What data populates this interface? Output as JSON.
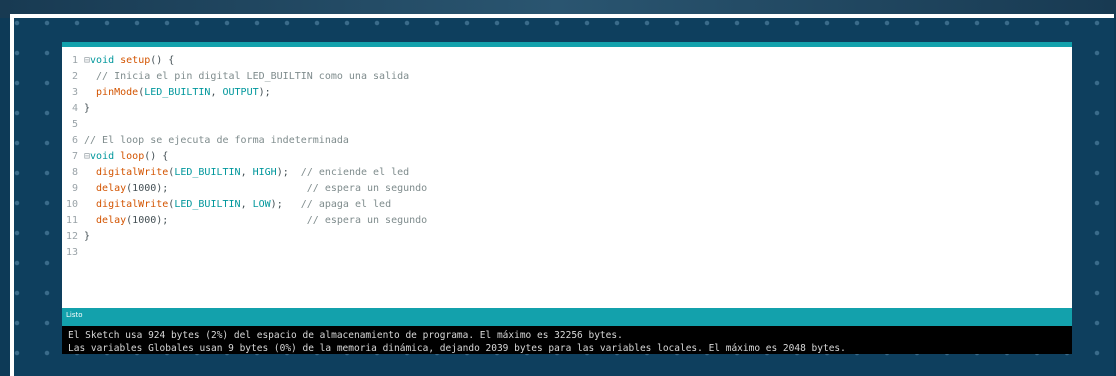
{
  "status_bar": {
    "label": "Listo"
  },
  "code": [
    {
      "n": "1",
      "fold": "⊟",
      "parts": [
        [
          "kw",
          "void "
        ],
        [
          "fn",
          "setup"
        ],
        [
          "",
          "() {"
        ]
      ]
    },
    {
      "n": "2",
      "fold": "",
      "parts": [
        [
          "cm",
          "  // Inicia el pin digital LED_BUILTIN como una salida"
        ]
      ]
    },
    {
      "n": "3",
      "fold": "",
      "parts": [
        [
          "fn",
          "  pinMode"
        ],
        [
          "",
          "("
        ],
        [
          "const",
          "LED_BUILTIN"
        ],
        [
          "",
          ", "
        ],
        [
          "const",
          "OUTPUT"
        ],
        [
          "",
          ");"
        ]
      ]
    },
    {
      "n": "4",
      "fold": "",
      "parts": [
        [
          "",
          "}"
        ]
      ]
    },
    {
      "n": "5",
      "fold": "",
      "parts": [
        [
          "",
          ""
        ]
      ]
    },
    {
      "n": "6",
      "fold": "",
      "parts": [
        [
          "cm",
          "// El loop se ejecuta de forma indeterminada"
        ]
      ]
    },
    {
      "n": "7",
      "fold": "⊟",
      "parts": [
        [
          "kw",
          "void "
        ],
        [
          "fn",
          "loop"
        ],
        [
          "",
          "() {"
        ]
      ]
    },
    {
      "n": "8",
      "fold": "",
      "parts": [
        [
          "fn",
          "  digitalWrite"
        ],
        [
          "",
          "("
        ],
        [
          "const",
          "LED_BUILTIN"
        ],
        [
          "",
          ", "
        ],
        [
          "const",
          "HIGH"
        ],
        [
          "",
          ");  "
        ],
        [
          "cm",
          "// enciende el led"
        ]
      ]
    },
    {
      "n": "9",
      "fold": "",
      "parts": [
        [
          "fn",
          "  delay"
        ],
        [
          "",
          "(1000);                       "
        ],
        [
          "cm",
          "// espera un segundo"
        ]
      ]
    },
    {
      "n": "10",
      "fold": "",
      "parts": [
        [
          "fn",
          "  digitalWrite"
        ],
        [
          "",
          "("
        ],
        [
          "const",
          "LED_BUILTIN"
        ],
        [
          "",
          ", "
        ],
        [
          "const",
          "LOW"
        ],
        [
          "",
          ");   "
        ],
        [
          "cm",
          "// apaga el led"
        ]
      ]
    },
    {
      "n": "11",
      "fold": "",
      "parts": [
        [
          "fn",
          "  delay"
        ],
        [
          "",
          "(1000);                       "
        ],
        [
          "cm",
          "// espera un segundo"
        ]
      ]
    },
    {
      "n": "12",
      "fold": "",
      "parts": [
        [
          "",
          "}"
        ]
      ]
    },
    {
      "n": "13",
      "fold": "",
      "parts": [
        [
          "",
          ""
        ]
      ]
    }
  ],
  "console": {
    "line1": "El Sketch usa 924 bytes (2%) del espacio de almacenamiento de programa. El máximo es 32256 bytes.",
    "line2": "Las variables Globales usan 9 bytes (0%) de la memoria dinámica, dejando 2039 bytes para las variables locales. El máximo es 2048 bytes."
  }
}
